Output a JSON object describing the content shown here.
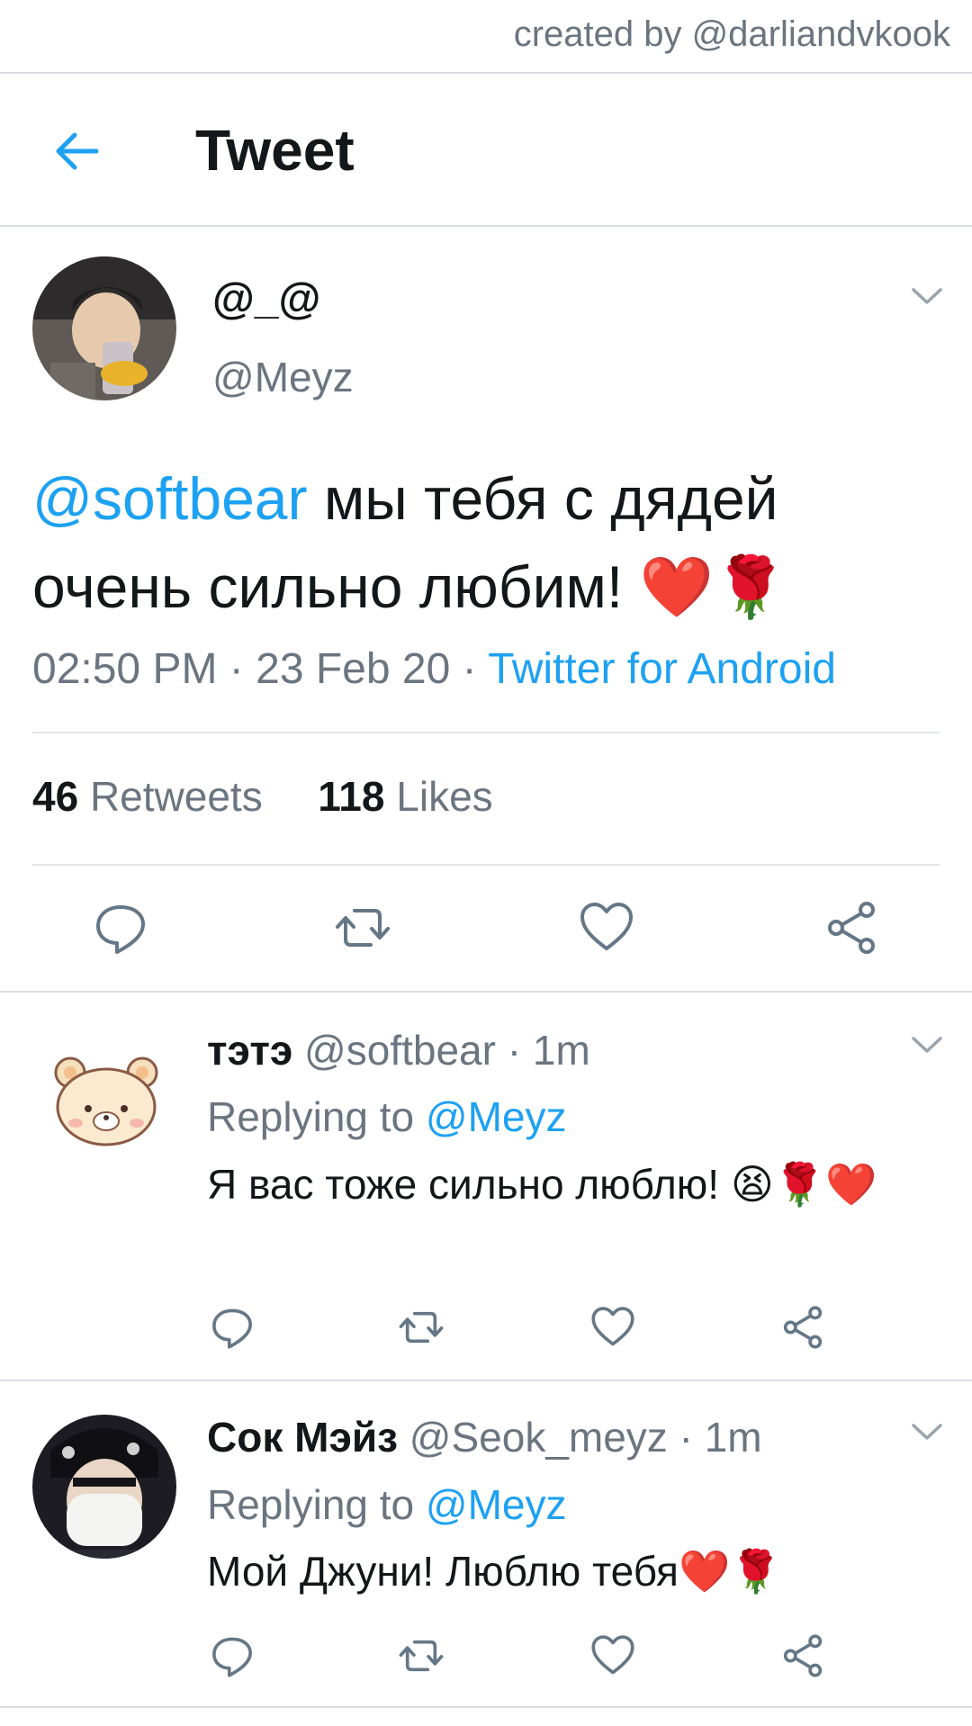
{
  "credit": "created by @darliandvkook",
  "header": {
    "title": "Tweet",
    "back_icon": "arrow-left-icon"
  },
  "tweet": {
    "display_name": "@_@",
    "handle": "@Meyz",
    "mention": "@softbear",
    "text": " мы тебя с дядей очень сильно любим! ❤️🌹",
    "time": "02:50 PM",
    "date": "23 Feb 20",
    "source": "Twitter for Android",
    "retweets_count": "46",
    "retweets_label": "Retweets",
    "likes_count": "118",
    "likes_label": "Likes"
  },
  "replies": [
    {
      "name": "тэтэ",
      "handle": "@softbear",
      "time": "1m",
      "replying_label": "Replying to",
      "replying_to": "@Meyz",
      "text": "Я вас тоже сильно люблю! 😫🌹❤️"
    },
    {
      "name": "Сок Мэйз",
      "handle": "@Seok_meyz",
      "time": "1m",
      "replying_label": "Replying to",
      "replying_to": "@Meyz",
      "text": "Мой Джуни! Люблю тебя❤️🌹"
    }
  ],
  "colors": {
    "accent": "#1da1f2",
    "muted": "#6b7580",
    "text": "#14171a",
    "divider": "#d9dde1"
  }
}
